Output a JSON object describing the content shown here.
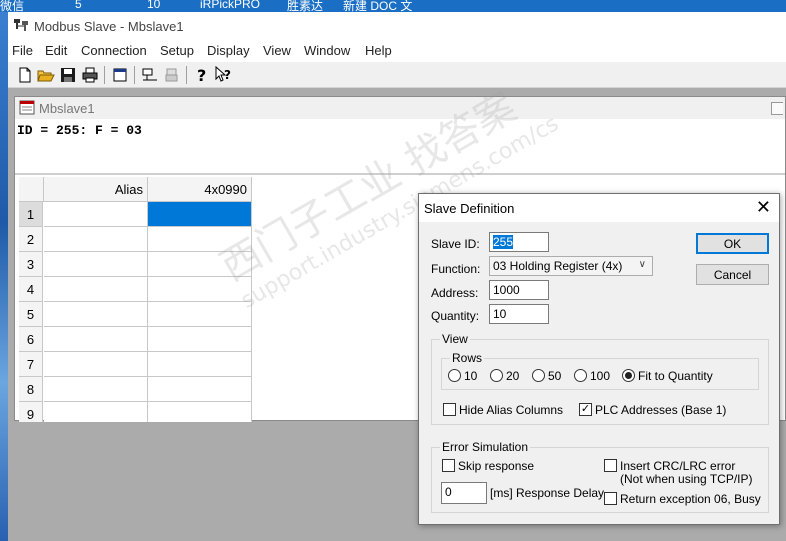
{
  "desktop": {
    "items": [
      "微信",
      "5",
      "10",
      "iRPickPRO",
      "胜素达",
      "新建 DOC 文"
    ]
  },
  "app": {
    "title": "Modbus Slave - Mbslave1",
    "menu": [
      "File",
      "Edit",
      "Connection",
      "Setup",
      "Display",
      "View",
      "Window",
      "Help"
    ],
    "toolbar_icons": [
      "new-icon",
      "open-icon",
      "save-icon",
      "print-icon",
      "window-icon",
      "connect-icon",
      "disconnect-icon",
      "help-icon",
      "context-help-icon"
    ]
  },
  "child": {
    "title": "Mbslave1",
    "info": "ID = 255: F = 03",
    "grid": {
      "columns": [
        "Alias",
        "4x0990"
      ],
      "rows": [
        "1",
        "2",
        "3",
        "4",
        "5",
        "6",
        "7",
        "8",
        "9"
      ],
      "selected_row": "1"
    }
  },
  "dialog": {
    "title": "Slave Definition",
    "slave_id_label": "Slave ID:",
    "slave_id_value": "255",
    "function_label": "Function:",
    "function_value": "03 Holding Register (4x)",
    "address_label": "Address:",
    "address_value": "1000",
    "quantity_label": "Quantity:",
    "quantity_value": "10",
    "ok_label": "OK",
    "cancel_label": "Cancel",
    "view_group": "View",
    "rows_group": "Rows",
    "rows_options": [
      "10",
      "20",
      "50",
      "100",
      "Fit to Quantity"
    ],
    "rows_selected": "Fit to Quantity",
    "hide_alias_label": "Hide Alias Columns",
    "hide_alias_checked": false,
    "plc_addresses_label": "PLC Addresses (Base 1)",
    "plc_addresses_checked": true,
    "error_group": "Error Simulation",
    "skip_response_label": "Skip response",
    "insert_crc_label": "Insert CRC/LRC error",
    "insert_crc_note": "(Not when using TCP/IP)",
    "response_delay_value": "0",
    "response_delay_label": "[ms] Response Delay",
    "return_exception_label": "Return exception 06, Busy"
  },
  "watermark": {
    "line1": "西门子工业 找答案",
    "line2": "support.industry.siemens.com/cs"
  },
  "colors": {
    "selection": "#0078d7",
    "workspace": "#ababab",
    "dialog_bg": "#f0f0f0"
  }
}
